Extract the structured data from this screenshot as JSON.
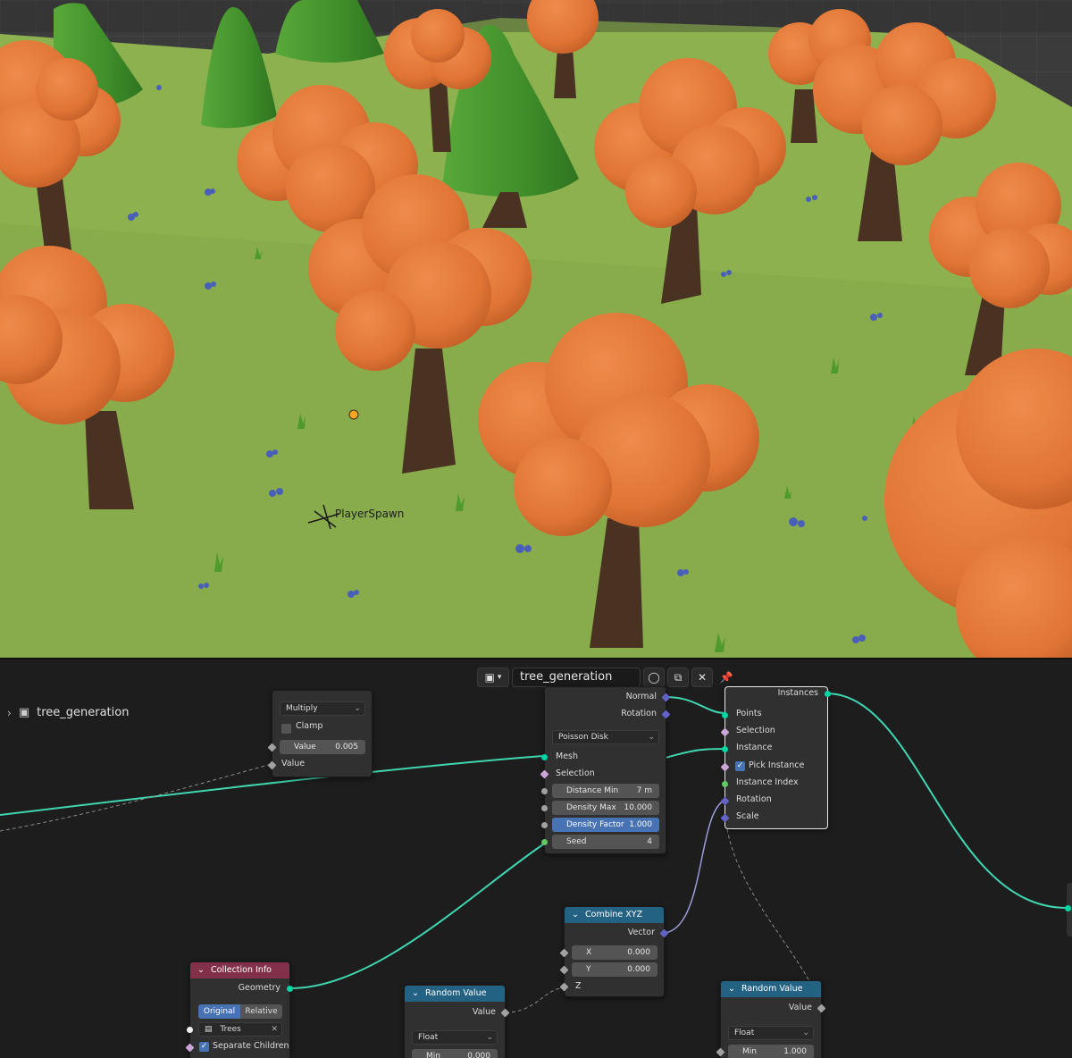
{
  "viewport": {
    "object_label": "PlayerSpawn"
  },
  "node_editor": {
    "header": {
      "node_tree_name": "tree_generation"
    },
    "sidebar_tree_name": "tree_generation",
    "math_node": {
      "operation": "Multiply",
      "clamp_label": "Clamp",
      "value_field_label": "Value",
      "value_field_value": "0.005",
      "input_label": "Value"
    },
    "distribute_node": {
      "outputs": [
        "Normal",
        "Rotation"
      ],
      "mode": "Poisson Disk",
      "inputs": [
        "Mesh",
        "Selection"
      ],
      "fields": [
        {
          "label": "Distance Min",
          "value": "7 m"
        },
        {
          "label": "Density Max",
          "value": "10.000"
        },
        {
          "label": "Density Factor",
          "value": "1.000"
        },
        {
          "label": "Seed",
          "value": "4"
        }
      ]
    },
    "instance_node": {
      "output": "Instances",
      "inputs": [
        "Points",
        "Selection",
        "Instance",
        "Pick Instance",
        "Instance Index",
        "Rotation",
        "Scale"
      ]
    },
    "combine_xyz_node": {
      "title": "Combine XYZ",
      "output": "Vector",
      "fields": [
        {
          "label": "X",
          "value": "0.000"
        },
        {
          "label": "Y",
          "value": "0.000"
        }
      ],
      "z_label": "Z"
    },
    "collection_info_node": {
      "title": "Collection Info",
      "output": "Geometry",
      "transform_options": [
        "Original",
        "Relative"
      ],
      "active_transform": "Original",
      "collection": "Trees",
      "separate_children_label": "Separate Children"
    },
    "random_value_1": {
      "title": "Random Value",
      "output": "Value",
      "data_type": "Float",
      "min_label": "Min",
      "min_value": "0.000"
    },
    "random_value_2": {
      "title": "Random Value",
      "output": "Value",
      "data_type": "Float",
      "min_label": "Min",
      "min_value": "1.000"
    }
  },
  "colors": {
    "geometry_socket": "#00d6a3",
    "header_function": "#246283",
    "header_input": "#83314a",
    "highlight_field": "#4772b3",
    "tree_foliage": "#e07a3a",
    "grass": "#8fb44e"
  }
}
